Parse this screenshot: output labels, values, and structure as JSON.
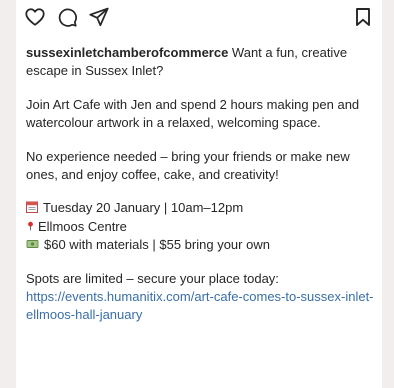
{
  "post": {
    "username": "sussexinletchamberofcommerce",
    "caption_intro": " Want a fun, creative escape in Sussex Inlet?",
    "paragraph_1": "Join Art Cafe with Jen and spend 2 hours making pen and watercolour artwork in a relaxed, welcoming space.",
    "paragraph_2": "No experience needed – bring your friends or make new ones, and enjoy coffee, cake, and creativity!",
    "details": {
      "date": "Tuesday 20 January | 10am–12pm",
      "location": "Ellmoos Centre",
      "price": "$60 with materials | $55 bring your own"
    },
    "cta": "Spots are limited – secure your place today:",
    "link": "https://events.humanitix.com/art-cafe-comes-to-sussex-inlet-ellmoos-hall-january"
  },
  "icons": {
    "like": "heart-icon",
    "comment": "comment-bubble-icon",
    "share": "send-arrow-icon",
    "save": "bookmark-icon",
    "calendar": "calendar-emoji",
    "pin": "round-pushpin-emoji",
    "money": "money-banknote-emoji"
  },
  "colors": {
    "text": "#262626",
    "link": "#3a6fa7"
  }
}
